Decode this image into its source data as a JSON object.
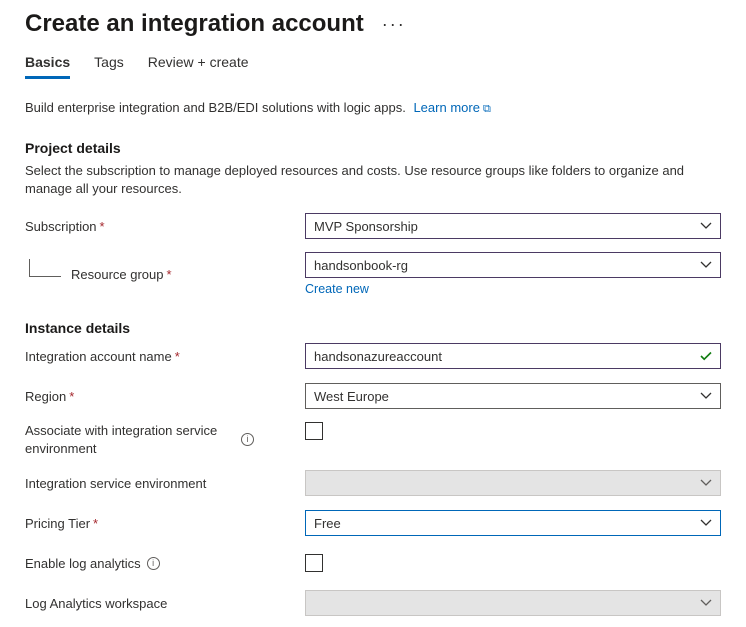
{
  "header": {
    "title": "Create an integration account"
  },
  "tabs": {
    "basics": "Basics",
    "tags": "Tags",
    "review": "Review + create"
  },
  "intro": {
    "text": "Build enterprise integration and B2B/EDI solutions with logic apps.",
    "learn_more": "Learn more"
  },
  "sections": {
    "project": {
      "heading": "Project details",
      "desc": "Select the subscription to manage deployed resources and costs. Use resource groups like folders to organize and manage all your resources."
    },
    "instance": {
      "heading": "Instance details"
    }
  },
  "fields": {
    "subscription": {
      "label": "Subscription",
      "value": "MVP Sponsorship"
    },
    "resource_group": {
      "label": "Resource group",
      "value": "handsonbook-rg",
      "create_new": "Create new"
    },
    "account_name": {
      "label": "Integration account name",
      "value": "handsonazureaccount"
    },
    "region": {
      "label": "Region",
      "value": "West Europe"
    },
    "associate_ise": {
      "label": "Associate with integration service environment"
    },
    "ise": {
      "label": "Integration service environment",
      "value": ""
    },
    "pricing_tier": {
      "label": "Pricing Tier",
      "value": "Free"
    },
    "enable_log": {
      "label": "Enable log analytics"
    },
    "log_workspace": {
      "label": "Log Analytics workspace",
      "value": ""
    }
  }
}
